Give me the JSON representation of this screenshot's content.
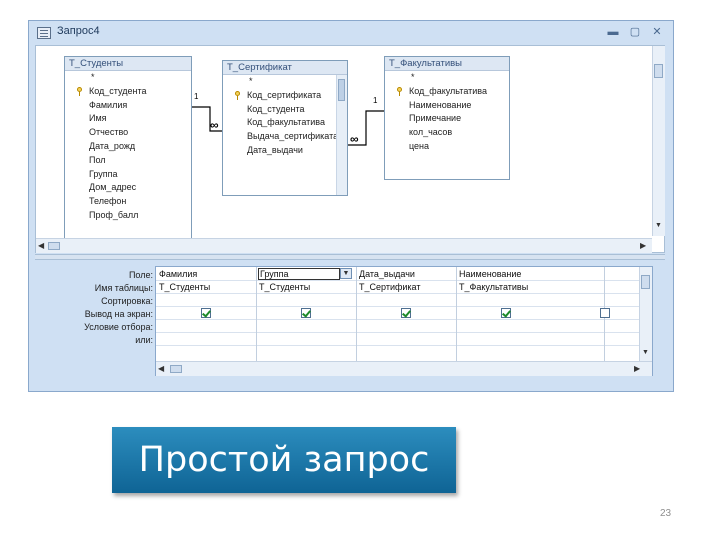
{
  "window": {
    "title": "Запрос4",
    "minimize": "▬",
    "restore": "▢",
    "close": "✕"
  },
  "tables": [
    {
      "name": "Т_Студенты",
      "star": "*",
      "key_field": "Код_студента",
      "fields": [
        "Фамилия",
        "Имя",
        "Отчество",
        "Дата_рожд",
        "Пол",
        "Группа",
        "Дом_адрес",
        "Телефон",
        "Проф_балл"
      ]
    },
    {
      "name": "Т_Сертификат",
      "star": "*",
      "key_field": "Код_сертификата",
      "fields": [
        "Код_студента",
        "Код_факультатива",
        "Выдача_сертификата",
        "Дата_выдачи"
      ]
    },
    {
      "name": "Т_Факультативы",
      "star": "*",
      "key_field": "Код_факультатива",
      "fields": [
        "Наименование",
        "Примечание",
        "кол_часов",
        "цена"
      ]
    }
  ],
  "relations": {
    "one": "1",
    "many": "∞"
  },
  "grid": {
    "row_labels": [
      "Поле:",
      "Имя таблицы:",
      "Сортировка:",
      "Вывод на экран:",
      "Условие отбора:",
      "или:"
    ],
    "columns": [
      {
        "field": "Фамилия",
        "table": "Т_Студенты",
        "show": true
      },
      {
        "field": "Группа",
        "table": "Т_Студенты",
        "show": true
      },
      {
        "field": "Дата_выдачи",
        "table": "Т_Сертификат",
        "show": true
      },
      {
        "field": "Наименование",
        "table": "Т_Факультативы",
        "show": true
      },
      {
        "field": "",
        "table": "",
        "show": false
      }
    ]
  },
  "caption": "Простой запрос",
  "page_number": "23"
}
